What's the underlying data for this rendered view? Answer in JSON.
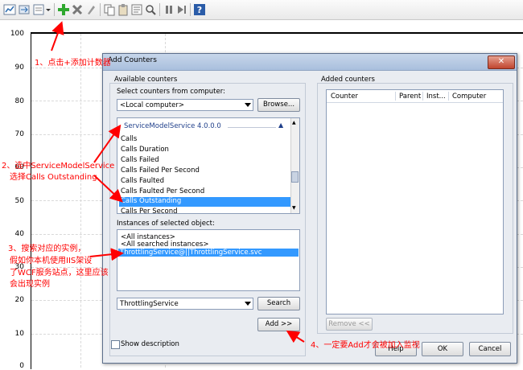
{
  "y_axis": {
    "ticks": [
      "100",
      "90",
      "80",
      "70",
      "60",
      "50",
      "40",
      "30",
      "20",
      "10",
      "0"
    ]
  },
  "dialog": {
    "title": "Add Counters",
    "available_counters_label": "Available counters",
    "select_from_label": "Select counters from computer:",
    "computer_value": "<Local computer>",
    "browse_label": "Browse...",
    "counter_group": "ServiceModelService 4.0.0.0",
    "counters": [
      "Calls",
      "Calls Duration",
      "Calls Failed",
      "Calls Failed Per Second",
      "Calls Faulted",
      "Calls Faulted Per Second",
      "Calls Outstanding",
      "Calls Per Second"
    ],
    "selected_counter": "Calls Outstanding",
    "instances_label": "Instances of selected object:",
    "instances": [
      "<All instances>",
      "<All searched instances>",
      "ThrottlingService@||ThrottlingService.svc"
    ],
    "selected_instance": "ThrottlingService@||ThrottlingService.svc",
    "search_value": "ThrottlingService",
    "search_label": "Search",
    "add_label": "Add >>",
    "show_description_label": "Show description",
    "added_counters_label": "Added counters",
    "added_columns": [
      "Counter",
      "Parent",
      "Inst...",
      "Computer"
    ],
    "remove_label": "Remove <<",
    "help_label": "Help",
    "ok_label": "OK",
    "cancel_label": "Cancel"
  },
  "annotations": {
    "step1": "1、点击+添加计数器",
    "step2_line1": "2、选中ServiceModelService",
    "step2_line2": "选择Calls Outstanding",
    "step3_line1": "3、搜索对应的实例，",
    "step3_line2": "假如你本机使用IIS架设",
    "step3_line3": "了WCF服务站点，这里应该",
    "step3_line4": "会出现实例",
    "step4": "4、一定要Add才会被加入监视",
    "color": "#ff0000"
  }
}
